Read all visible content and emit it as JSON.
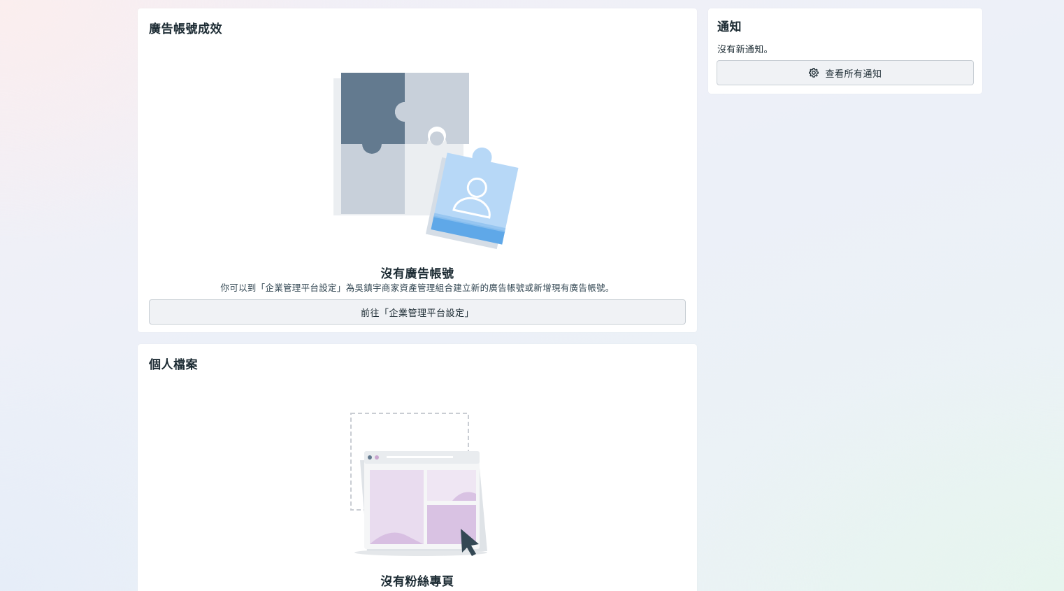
{
  "ad_accounts_card": {
    "title": "廣告帳號成效",
    "empty_title": "沒有廣告帳號",
    "empty_description": "你可以到「企業管理平台設定」為吳鎮宇商家資產管理組合建立新的廣告帳號或新增現有廣告帳號。",
    "button_label": "前往「企業管理平台設定」",
    "illustration_icon": "puzzle-user-icon"
  },
  "profile_card": {
    "title": "個人檔案",
    "empty_title": "沒有粉絲專頁",
    "illustration_icon": "browser-window-cursor-icon"
  },
  "notifications_card": {
    "title": "通知",
    "empty_text": "沒有新通知。",
    "button_label": "查看所有通知",
    "button_icon": "gear-icon"
  },
  "colors": {
    "puzzle_dark": "#637a8f",
    "puzzle_light": "#c8d0da",
    "puzzle_blue": "#b7d8f7",
    "window_purple": "#e9dcef"
  }
}
